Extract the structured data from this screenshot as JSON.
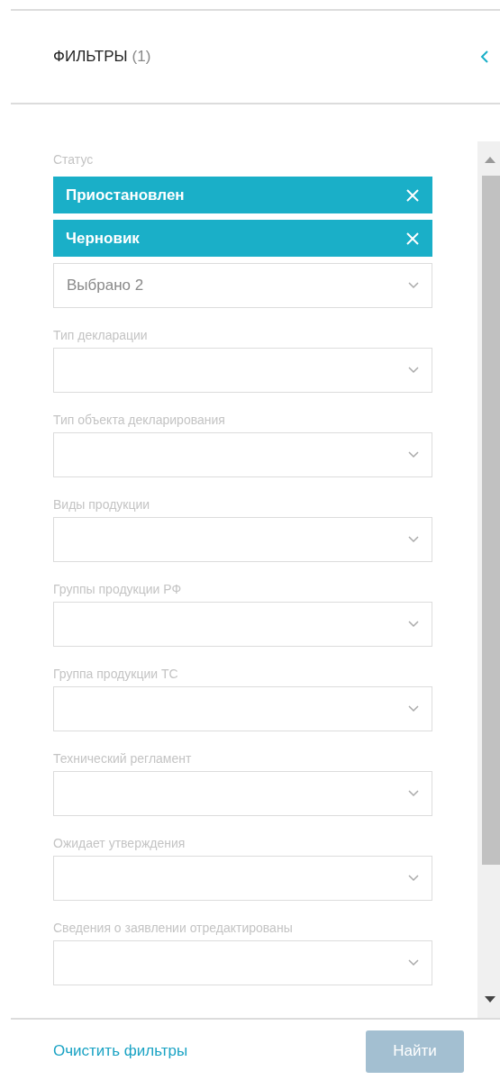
{
  "header": {
    "title": "ФИЛЬТРЫ",
    "count": "(1)"
  },
  "status": {
    "label": "Статус",
    "chips": [
      {
        "label": "Приостановлен",
        "selected": true
      },
      {
        "label": "Черновик",
        "selected": true
      }
    ],
    "value": "Выбрано 2"
  },
  "filters": [
    {
      "label": "Тип декларации"
    },
    {
      "label": "Тип объекта декларирования"
    },
    {
      "label": "Виды продукции"
    },
    {
      "label": "Группы продукции РФ"
    },
    {
      "label": "Группа продукции ТС"
    },
    {
      "label": "Технический регламент"
    },
    {
      "label": "Ожидает утверждения"
    },
    {
      "label": "Сведения о заявлении отредактированы"
    }
  ],
  "footer": {
    "clear": "Очистить фильтры",
    "search": {
      "label": "Найти",
      "disabled": true
    }
  }
}
